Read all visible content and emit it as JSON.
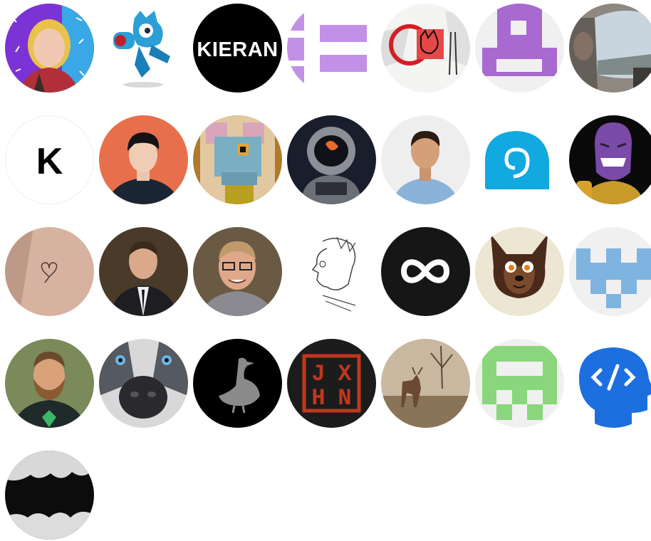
{
  "avatars": [
    {
      "id": "a1",
      "text": ""
    },
    {
      "id": "a2",
      "text": ""
    },
    {
      "id": "a3",
      "text": "KIERAN"
    },
    {
      "id": "a4",
      "text": ""
    },
    {
      "id": "a5",
      "text": ""
    },
    {
      "id": "a6",
      "text": ""
    },
    {
      "id": "a7",
      "text": ""
    },
    {
      "id": "a8",
      "text": "K"
    },
    {
      "id": "a9",
      "text": ""
    },
    {
      "id": "a10",
      "text": ""
    },
    {
      "id": "a11",
      "text": ""
    },
    {
      "id": "a12",
      "text": ""
    },
    {
      "id": "a13",
      "text": ""
    },
    {
      "id": "a14",
      "text": ""
    },
    {
      "id": "a15",
      "text": ""
    },
    {
      "id": "a16",
      "text": ""
    },
    {
      "id": "a17",
      "text": ""
    },
    {
      "id": "a18",
      "text": ""
    },
    {
      "id": "a19",
      "text": "∞"
    },
    {
      "id": "a20",
      "text": ""
    },
    {
      "id": "a21",
      "text": ""
    },
    {
      "id": "a22",
      "text": ""
    },
    {
      "id": "a23",
      "text": ""
    },
    {
      "id": "a24",
      "text": ""
    },
    {
      "id": "a25",
      "text": [
        "J",
        "X",
        "H",
        "N"
      ]
    },
    {
      "id": "a26",
      "text": ""
    },
    {
      "id": "a27",
      "text": ""
    },
    {
      "id": "a28",
      "text": "</>"
    },
    {
      "id": "a29",
      "text": ""
    }
  ],
  "colors": {
    "purple_bg": "#8b3bd9",
    "teal_bg": "#36c5e8",
    "lilac": "#c290e6",
    "orange": "#e86f4c",
    "green": "#89d67c",
    "blue_pattern": "#7fb3e0",
    "brain_blue": "#1d6fe0",
    "jxhn_red": "#c2361c"
  }
}
